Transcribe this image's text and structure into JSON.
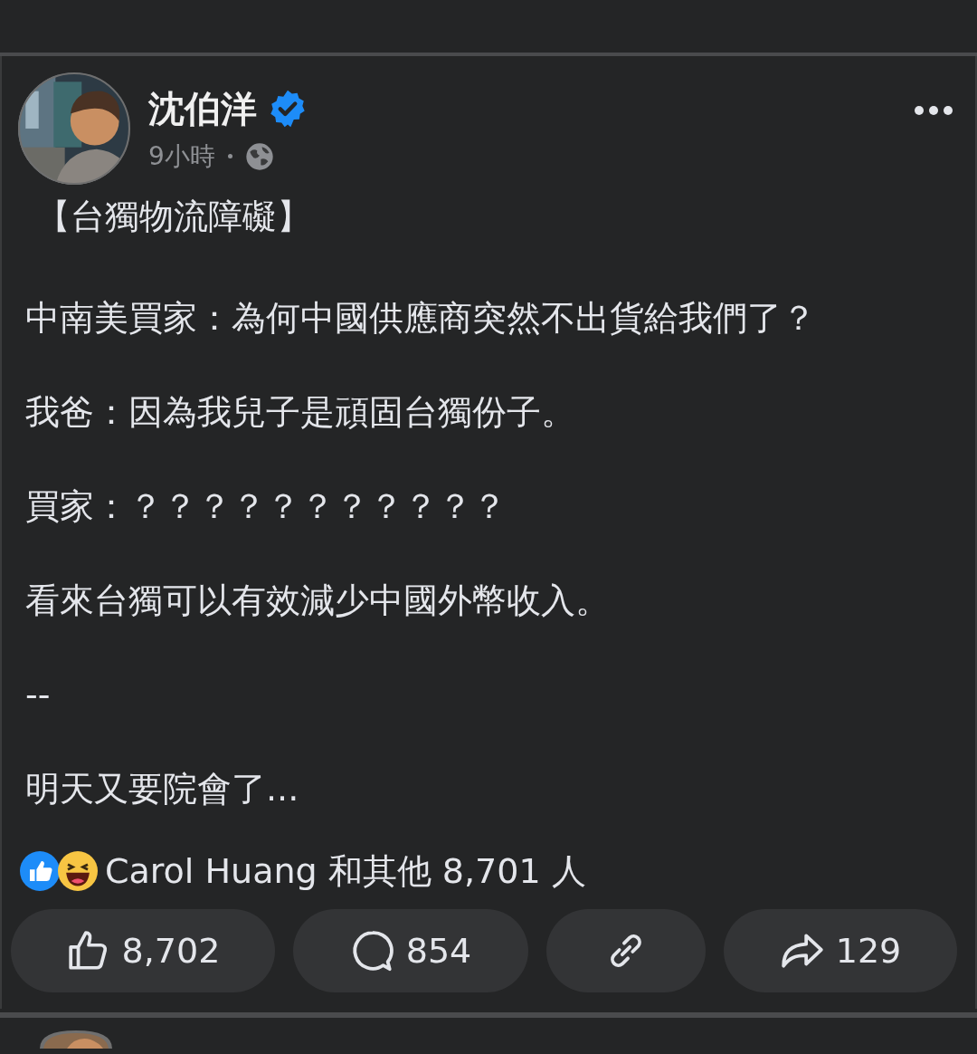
{
  "post": {
    "author": "沈伯洋",
    "verified": true,
    "time": "9小時",
    "public": true,
    "paragraphs": [
      "【台獨物流障礙】",
      "中南美買家：為何中國供應商突然不出貨給我們了？",
      "我爸：因為我兒子是頑固台獨份子。",
      "買家：？？？？？？？？？？？",
      "看來台獨可以有效減少中國外幣收入。",
      "--",
      "明天又要院會了..."
    ],
    "reactions_summary": "Carol Huang 和其他 8,701 人",
    "actions": [
      {
        "kind": "like",
        "count": "8,702"
      },
      {
        "kind": "comment",
        "count": "854"
      },
      {
        "kind": "link"
      },
      {
        "kind": "share",
        "count": "129"
      }
    ]
  }
}
